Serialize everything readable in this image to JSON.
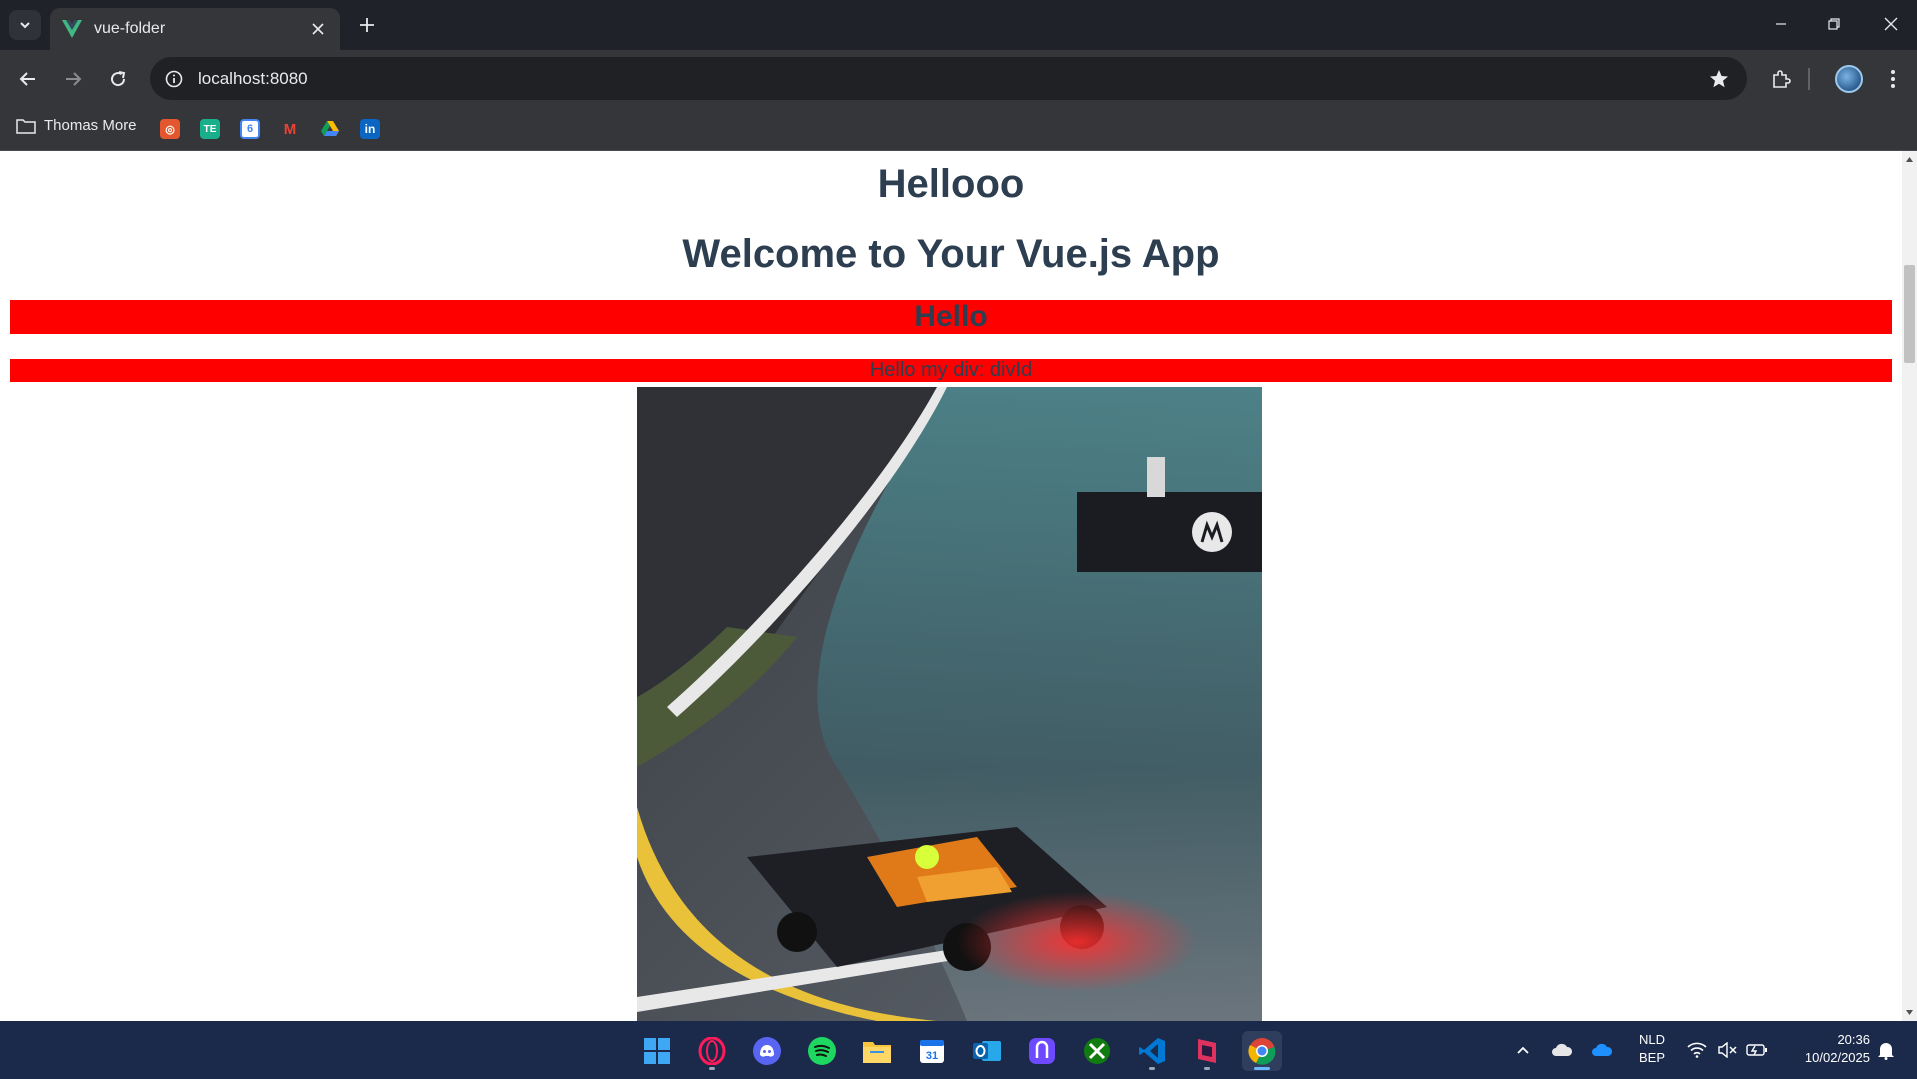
{
  "browser": {
    "tab": {
      "title": "vue-folder"
    },
    "url": "localhost:8080",
    "bookmarks": {
      "folder_label": "Thomas More",
      "items": [
        {
          "icon": "canvas-icon",
          "color": "#e4572e",
          "glyph": "◎"
        },
        {
          "icon": "teams-te-icon",
          "color": "#1aaf8b",
          "glyph": "TE"
        },
        {
          "icon": "google-calendar-icon",
          "color": "#4285f4",
          "glyph": "6"
        },
        {
          "icon": "gmail-icon",
          "color": "#ffffff",
          "glyph": "M"
        },
        {
          "icon": "google-drive-icon",
          "color": "#ffffff",
          "glyph": "▲"
        },
        {
          "icon": "linkedin-icon",
          "color": "#0a66c2",
          "glyph": "in"
        }
      ]
    }
  },
  "page": {
    "heading1": "Hellooo",
    "heading2": "Welcome to Your Vue.js App",
    "red_heading": "Hello",
    "red_div": "Hello my div: divId"
  },
  "colors": {
    "highlight_bg": "#ff0000",
    "text": "#2c3e50"
  },
  "taskbar": {
    "apps": [
      "windows-start-icon",
      "opera-gx-icon",
      "discord-icon",
      "spotify-icon",
      "file-explorer-icon",
      "calendar-icon",
      "outlook-icon",
      "proton-pass-icon",
      "xbox-icon",
      "vscode-icon",
      "app-icon",
      "chrome-icon"
    ],
    "language": "NLD",
    "keyboard": "BEP",
    "time": "20:36",
    "date": "10/02/2025"
  }
}
